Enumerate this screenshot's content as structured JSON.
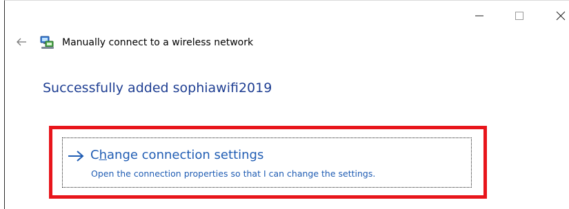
{
  "window": {
    "title_text": "Manually connect to a wireless network",
    "controls": [
      "minimize-icon",
      "maximize-icon",
      "close-icon"
    ]
  },
  "header": {
    "back_icon": "back-arrow-icon",
    "network_icon": "network-icon",
    "title": "Manually connect to a wireless network"
  },
  "main": {
    "success_message": "Successfully added sophiawifi2019",
    "command_link": {
      "icon": "arrow-right-icon",
      "title_prefix": "C",
      "title_accel": "h",
      "title_rest": "ange connection settings",
      "description": "Open the connection properties so that I can change the settings."
    }
  },
  "colors": {
    "heading_blue": "#1e3e92",
    "link_blue": "#1f5cb3",
    "highlight_red": "#e8151b"
  }
}
